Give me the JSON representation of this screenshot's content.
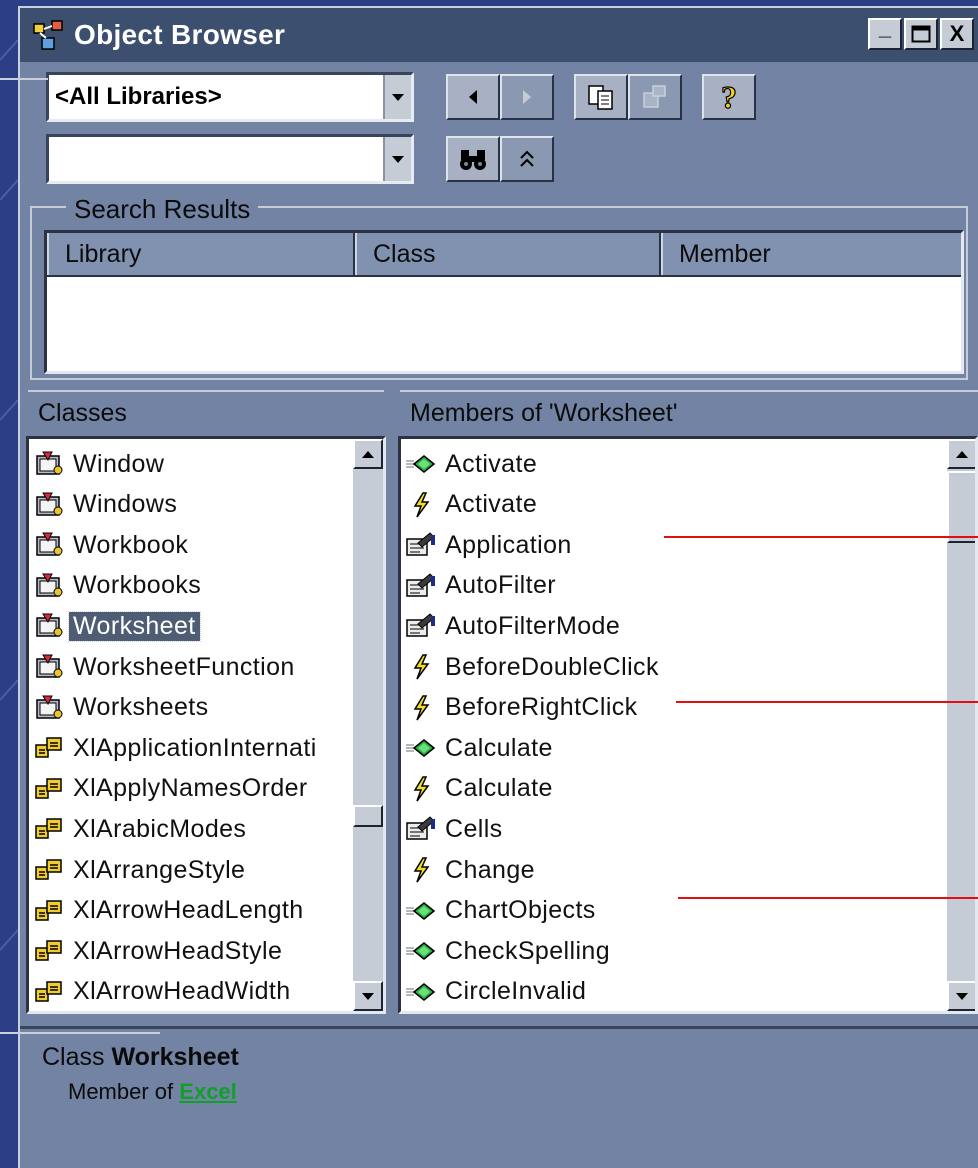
{
  "window": {
    "title": "Object Browser",
    "controls": {
      "minimize": "_",
      "maximize": "□",
      "close": "X"
    }
  },
  "toolbar": {
    "library_combo": {
      "value": "<All Libraries>"
    },
    "search_combo": {
      "value": ""
    },
    "buttons": [
      {
        "name": "go-back-button",
        "icon": "left-arrow-icon"
      },
      {
        "name": "go-forward-button",
        "icon": "right-arrow-icon"
      },
      {
        "name": "copy-to-clipboard-button",
        "icon": "copy-icon"
      },
      {
        "name": "view-definition-button",
        "icon": "view-definition-icon"
      },
      {
        "name": "help-button",
        "icon": "question-mark-icon"
      },
      {
        "name": "search-button",
        "icon": "binoculars-icon"
      },
      {
        "name": "show-hide-results-button",
        "icon": "double-chevron-up-icon"
      }
    ]
  },
  "search_results": {
    "title": "Search Results",
    "columns": [
      "Library",
      "Class",
      "Member"
    ],
    "rows": []
  },
  "classes": {
    "header": "Classes",
    "selected": "Worksheet",
    "items": [
      {
        "label": "Window",
        "icon": "class-icon"
      },
      {
        "label": "Windows",
        "icon": "class-icon"
      },
      {
        "label": "Workbook",
        "icon": "class-icon"
      },
      {
        "label": "Workbooks",
        "icon": "class-icon"
      },
      {
        "label": "Worksheet",
        "icon": "class-icon"
      },
      {
        "label": "WorksheetFunction",
        "icon": "class-icon"
      },
      {
        "label": "Worksheets",
        "icon": "class-icon"
      },
      {
        "label": "XlApplicationInternati",
        "icon": "enum-icon"
      },
      {
        "label": "XlApplyNamesOrder",
        "icon": "enum-icon"
      },
      {
        "label": "XlArabicModes",
        "icon": "enum-icon"
      },
      {
        "label": "XlArrangeStyle",
        "icon": "enum-icon"
      },
      {
        "label": "XlArrowHeadLength",
        "icon": "enum-icon"
      },
      {
        "label": "XlArrowHeadStyle",
        "icon": "enum-icon"
      },
      {
        "label": "XlArrowHeadWidth",
        "icon": "enum-icon"
      }
    ]
  },
  "members": {
    "header": "Members of 'Worksheet'",
    "items": [
      {
        "label": "Activate",
        "icon": "method-icon"
      },
      {
        "label": "Activate",
        "icon": "event-icon"
      },
      {
        "label": "Application",
        "icon": "property-icon"
      },
      {
        "label": "AutoFilter",
        "icon": "property-icon"
      },
      {
        "label": "AutoFilterMode",
        "icon": "property-icon"
      },
      {
        "label": "BeforeDoubleClick",
        "icon": "event-icon"
      },
      {
        "label": "BeforeRightClick",
        "icon": "event-icon"
      },
      {
        "label": "Calculate",
        "icon": "method-icon"
      },
      {
        "label": "Calculate",
        "icon": "event-icon"
      },
      {
        "label": "Cells",
        "icon": "property-icon"
      },
      {
        "label": "Change",
        "icon": "event-icon"
      },
      {
        "label": "ChartObjects",
        "icon": "method-icon"
      },
      {
        "label": "CheckSpelling",
        "icon": "method-icon"
      },
      {
        "label": "CircleInvalid",
        "icon": "method-icon"
      }
    ]
  },
  "details": {
    "prefix": "Class",
    "name": "Worksheet",
    "member_of_label": "Member of",
    "library_link": "Excel"
  },
  "colors": {
    "background": "#2c3f86",
    "window": "#7283a3",
    "titlebar": "#3d4f6f",
    "selection": "#4e5d74",
    "annotation_line": "#e01010",
    "link": "#10a028"
  }
}
